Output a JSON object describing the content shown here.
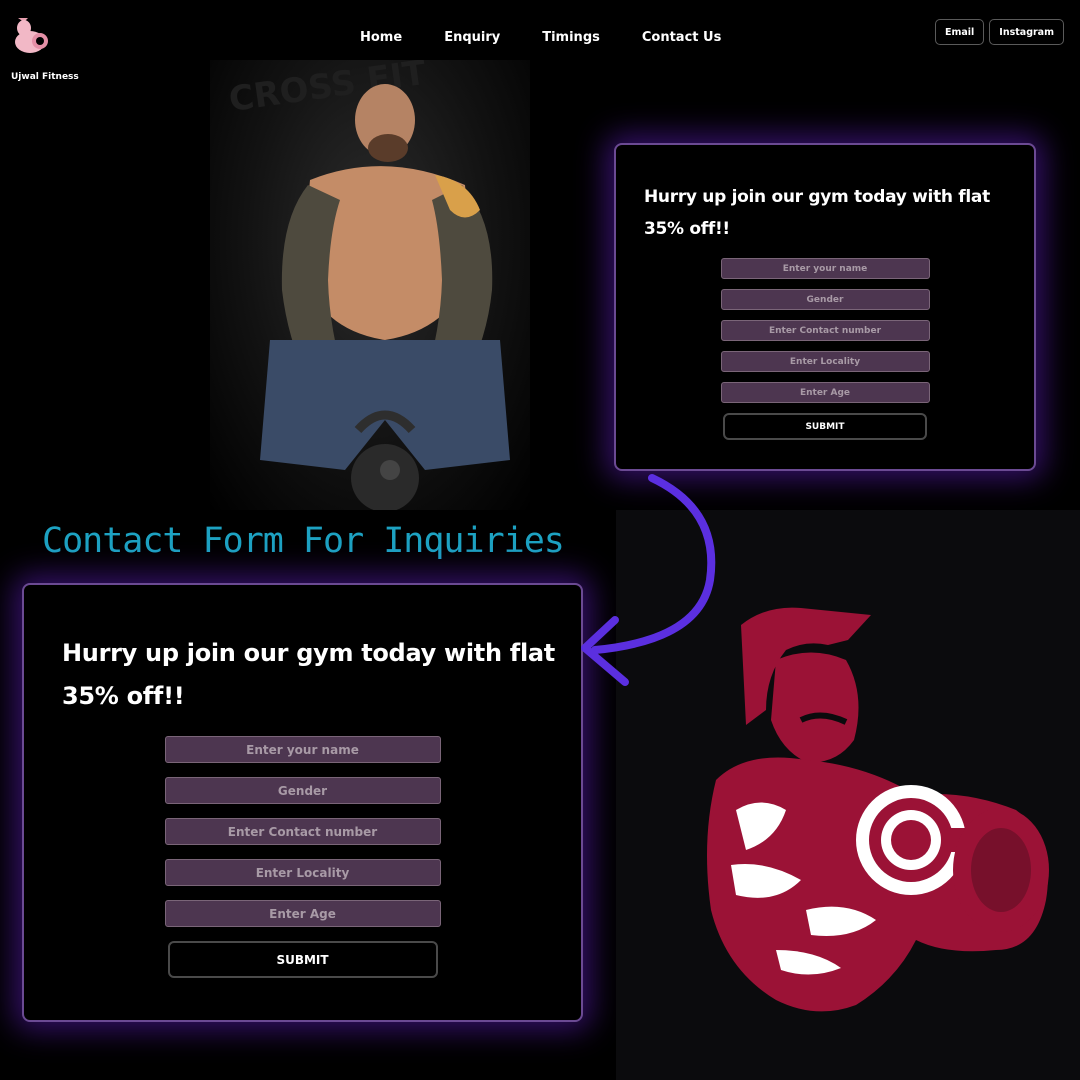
{
  "site": {
    "brand": "Ujwal Fitness",
    "nav": [
      "Home",
      "Enquiry",
      "Timings",
      "Contact Us"
    ],
    "buttons": [
      "Email",
      "Instagram"
    ]
  },
  "form": {
    "title_line1": "Hurry up join our gym today with flat",
    "title_line2": "35% off!!",
    "placeholders": {
      "name": "Enter your name",
      "gender": "Gender",
      "contact": "Enter Contact number",
      "locality": "Enter Locality",
      "age": "Enter Age"
    },
    "submit_label": "SUBMIT"
  },
  "caption": "Contact Form For Inquiries",
  "colors": {
    "caption": "#1da2c2",
    "arrow": "#5b2fe0",
    "logo_red": "#9b1236",
    "card_glow": "#5f1ebe",
    "input_bg": "#4d3650"
  },
  "icons": [
    "brand-logo-icon",
    "muscle-man-logo-icon",
    "curved-arrow-icon"
  ]
}
